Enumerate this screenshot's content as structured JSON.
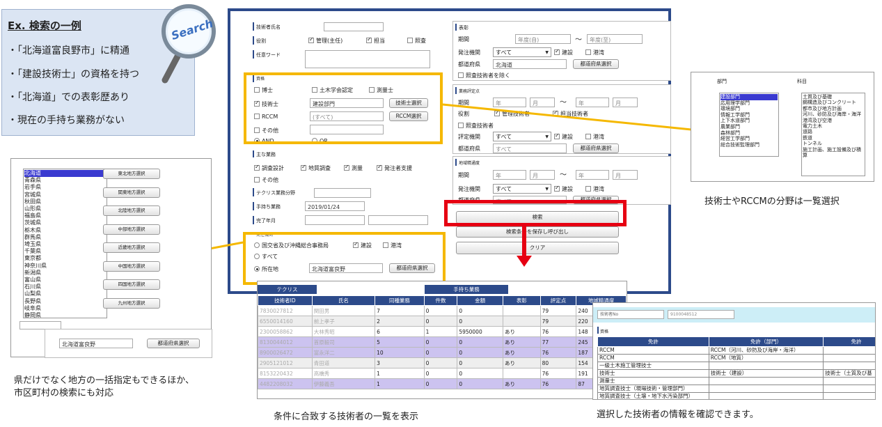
{
  "callout": {
    "title": "Ex. 検索の一例",
    "items": [
      "・「北海道富良野市」に精通",
      "・「建設技術士」の資格を持つ",
      "・「北海道」での表彰歴あり",
      "・現在の手持ち業務がない"
    ],
    "search_text": "Search"
  },
  "form": {
    "name_label": "技術者氏名",
    "role_label": "役割",
    "role_manager": "管理(主任)",
    "role_charge": "担当",
    "role_check": "照査",
    "freeword_label": "任意ワード",
    "qual_label": "資格",
    "hakase": "博士",
    "doboku": "土木学会認定",
    "sokuryo_shi": "測量士",
    "gijutsushi": "技術士",
    "gijutsushi_value": "建設部門",
    "gijutsushi_btn": "技術士選択",
    "rccm": "RCCM",
    "rccm_placeholder": "(すべて)",
    "rccm_btn": "RCCM選択",
    "other": "その他",
    "and": "AND",
    "or": "OR",
    "main_work_label": "主な業務",
    "work_survey": "調査設計",
    "work_geo": "地質調査",
    "work_measure": "測量",
    "work_support": "発注者支援",
    "work_other": "その他",
    "techris_label": "テクリス業務分野",
    "temochi_label": "手持ち業務",
    "temochi_value": "2019/01/24",
    "kanryo_label": "完了年月",
    "orderer_section": "発注機関",
    "kokudo": "国交省及び沖縄総合事務局",
    "kensetsu": "建設",
    "kowan": "港湾",
    "subete": "すべて",
    "shozaichi": "所在地",
    "shozaichi_value": "北海道富良野",
    "todofuken_btn": "都道府県選択",
    "award_label": "表彰",
    "period": "期間",
    "year_from": "年度(自)",
    "year_to": "年度(至)",
    "tilde": "〜",
    "hatchu_kikan": "発注機関",
    "subete_opt": "すべて",
    "todofuken": "都道府県",
    "todofuken_value": "北海道",
    "shosa_exclude": "照査技術者を除く",
    "hyotei_label": "業務評定点",
    "nen": "年",
    "tsuki": "月",
    "yakuwari": "役割",
    "kanri_gijutsu": "管理技術者",
    "tanto_gijutsu": "担当技術者",
    "shosa_gijutsu": "照査技術者",
    "hyotei_kikan": "評定機関",
    "chiiki_label": "地域精通度",
    "search_btn": "検索",
    "save_btn": "検索条件を保存し呼び出し",
    "clear_btn": "クリア"
  },
  "prefs": {
    "list": [
      "北海道",
      "青森県",
      "岩手県",
      "宮城県",
      "秋田県",
      "山形県",
      "福島県",
      "茨城県",
      "栃木県",
      "群馬県",
      "埼玉県",
      "千葉県",
      "東京都",
      "神奈川県",
      "新潟県",
      "富山県",
      "石川県",
      "山梨県",
      "長野県",
      "岐阜県",
      "静岡県"
    ],
    "region_buttons": [
      "東北地方選択",
      "関東地方選択",
      "北陸地方選択",
      "中部地方選択",
      "近畿地方選択",
      "中国地方選択",
      "四国地方選択",
      "九州地方選択"
    ],
    "input_value": "北海道富良野",
    "select_btn": "都道府県選択",
    "caption_line1": "県だけでなく地方の一括指定もできるほか、",
    "caption_line2": "市区町村の検索にも対応"
  },
  "field_popup": {
    "col1": "部門",
    "col2": "科目",
    "left_items": [
      "建設部門",
      "応用理学部門",
      "環境部門",
      "情報工学部門",
      "上下水道部門",
      "農業部門",
      "森林部門",
      "経営工学部門",
      "総合技術監理部門"
    ],
    "right_items": [
      "土質及び基礎",
      "鋼構造及びコンクリート",
      "都市及び地方計画",
      "河川、砂防及び海岸・海洋",
      "港湾及び空港",
      "電力土木",
      "道路",
      "鉄道",
      "トンネル",
      "施工計画、施工設備及び積算"
    ],
    "caption": "技術士やRCCMの分野は一覧選択"
  },
  "results": {
    "group_techris": "テクリス",
    "group_temochi": "手持ち業務",
    "headers": [
      "技術者ID",
      "氏名",
      "同種業務",
      "件数",
      "金額",
      "表彰",
      "評定点",
      "地域精通度"
    ],
    "rows": [
      [
        "7830027812",
        "関田男",
        "7",
        "0",
        "0",
        "",
        "79",
        "240"
      ],
      [
        "6550014160",
        "前上孝子",
        "2",
        "0",
        "0",
        "",
        "79",
        "220"
      ],
      [
        "2300058862",
        "大林秀昭",
        "6",
        "1",
        "5950000",
        "あり",
        "76",
        "148"
      ],
      [
        "8130044012",
        "首原毅司",
        "5",
        "0",
        "0",
        "あり",
        "77",
        "245"
      ],
      [
        "8900026472",
        "富永洋二",
        "10",
        "0",
        "0",
        "あり",
        "76",
        "187"
      ],
      [
        "2905121012",
        "青田道",
        "3",
        "0",
        "0",
        "あり",
        "80",
        "154"
      ],
      [
        "8153220432",
        "高橋秀",
        "1",
        "0",
        "0",
        "",
        "76",
        "191"
      ],
      [
        "4482208032",
        "伊藤義吾",
        "1",
        "0",
        "0",
        "あり",
        "76",
        "87"
      ]
    ],
    "caption": "条件に合致する技術者の一覧を表示"
  },
  "detail": {
    "id_label": "技術者No",
    "id_value": "9100048512",
    "section": "資格",
    "col_a": "免許",
    "col_b": "免許（部門）",
    "col_c": "免許",
    "rows": [
      [
        "RCCM",
        "RCCM（河川、砂防及び海岸・海洋）",
        ""
      ],
      [
        "RCCM",
        "RCCM（地質）",
        ""
      ],
      [
        "一級土木施工管理技士",
        "",
        ""
      ],
      [
        "技術士",
        "技術士（建設）",
        "技術士（土質及び基"
      ],
      [
        "測量士",
        "",
        ""
      ],
      [
        "地質調査技士（現場技術・管理部門）",
        "",
        ""
      ],
      [
        "地質調査技士（土壌・地下水汚染部門）",
        "",
        ""
      ]
    ],
    "caption": "選択した技術者の情報を確認できます。"
  },
  "colors": {
    "navy": "#2c4a8a",
    "yellow": "#f5b800",
    "red": "#e60012",
    "callout_bg": "#dbe5f3",
    "purple": "#ccc3f0",
    "header_blue": "#2c4a8a",
    "cyan": "#cdeef7"
  }
}
